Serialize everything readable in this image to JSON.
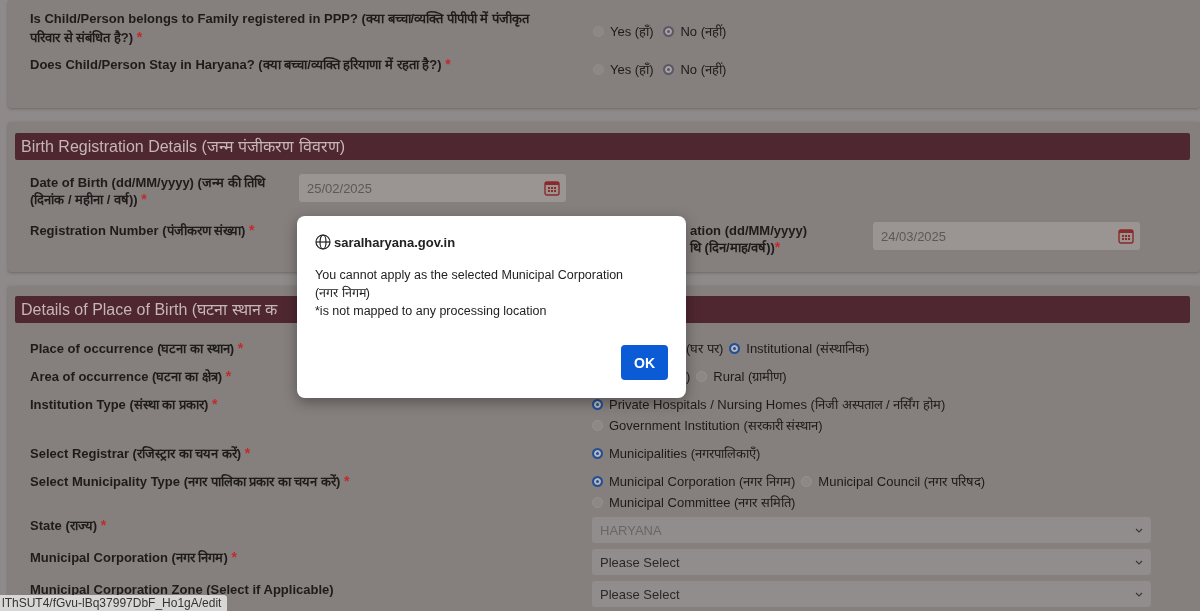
{
  "family_section": {
    "questions": [
      {
        "label": "Is Child/Person belongs to Family registered in PPP? (क्या बच्चा/व्यक्ति पीपीपी में पंजीकृत परिवार से संबंधित है?)",
        "asterisk": "*",
        "disabled": true,
        "options": [
          {
            "label": "Yes (हाँ)",
            "selected": false
          },
          {
            "label": "No (नहीं)",
            "selected": true
          }
        ]
      },
      {
        "label": "Does Child/Person Stay in Haryana? (क्या बच्चा/व्यक्ति हरियाणा में रहता है?)",
        "asterisk": "*",
        "disabled": true,
        "options": [
          {
            "label": "Yes (हाँ)",
            "selected": false
          },
          {
            "label": "No (नहीं)",
            "selected": true
          }
        ]
      }
    ]
  },
  "birth_registration": {
    "title": "Birth Registration Details (जन्म पंजीकरण विवरण)",
    "date_of_birth": {
      "label": "Date of Birth (dd/MM/yyyy) (जन्म की तिथि (दिनांक / महीना / वर्ष))",
      "asterisk": "*",
      "value": "25/02/2025"
    },
    "registration_number": {
      "label": "Registration Number (पंजीकरण संख्या)",
      "asterisk": "*"
    },
    "date_of_registration": {
      "label_lines": [
        "ation (dd/MM/yyyy)",
        "थि (दिन/माह/वर्ष))"
      ],
      "asterisk": "*",
      "value": "24/03/2025"
    }
  },
  "place_of_birth": {
    "title": "Details of Place of Birth (घटना स्थान क",
    "rows": [
      {
        "kind": "radio",
        "label": "Place of occurrence (घटना का स्थान)",
        "asterisk": "*",
        "options": [
          {
            "kind": "fragment",
            "label": "(घर पर)"
          },
          {
            "kind": "radio",
            "label": "Institutional (संस्थानिक)",
            "selected": true
          }
        ]
      },
      {
        "kind": "radio",
        "label": "Area of occurrence (घटना का क्षेत्र)",
        "asterisk": "*",
        "options": [
          {
            "kind": "fragment",
            "label": ")"
          },
          {
            "kind": "radio",
            "label": "Rural (ग्रामीण)",
            "selected": false
          }
        ]
      },
      {
        "kind": "radio",
        "label": "Institution Type (संस्था का प्रकार)",
        "asterisk": "*",
        "options": [
          {
            "kind": "radio",
            "label": "Private Hospitals / Nursing Homes (निजी अस्पताल / नर्सिंग होम)",
            "selected": true
          },
          {
            "kind": "radio",
            "label": "Government Institution (सरकारी संस्थान)",
            "selected": false
          }
        ]
      },
      {
        "kind": "radio",
        "label": "Select Registrar (रजिस्ट्रार का चयन करें)",
        "asterisk": "*",
        "options": [
          {
            "kind": "radio",
            "label": "Municipalities (नगरपालिकाएँ)",
            "selected": true
          }
        ]
      },
      {
        "kind": "radio",
        "label": "Select Municipality Type (नगर पालिका प्रकार का चयन करें)",
        "asterisk": "*",
        "options": [
          {
            "kind": "radio",
            "label": "Municipal Corporation (नगर निगम)",
            "selected": true
          },
          {
            "kind": "radio",
            "label": "Municipal Council (नगर परिषद)",
            "selected": false
          },
          {
            "kind": "radio",
            "label": "Municipal Committee (नगर समिति)",
            "selected": false
          }
        ]
      },
      {
        "kind": "select",
        "label": "State (राज्य)",
        "asterisk": "*",
        "value": "HARYANA",
        "disabled": true
      },
      {
        "kind": "select",
        "label": "Municipal Corporation (नगर निगम)",
        "asterisk": "*",
        "value": "Please Select",
        "disabled": false
      },
      {
        "kind": "select",
        "label": "Municipal Corporation Zone (Select if Applicable)",
        "value": "Please Select",
        "disabled": false
      }
    ]
  },
  "dialog": {
    "site": "saralharyana.gov.in",
    "message_lines": [
      "You cannot apply as the selected Municipal Corporation",
      "(नगर निगम)",
      "*is not mapped to any processing location"
    ],
    "button": "OK"
  },
  "status_url": "lThSUT4/fGvu-lBq37997DbF_Ho1gA/edit"
}
